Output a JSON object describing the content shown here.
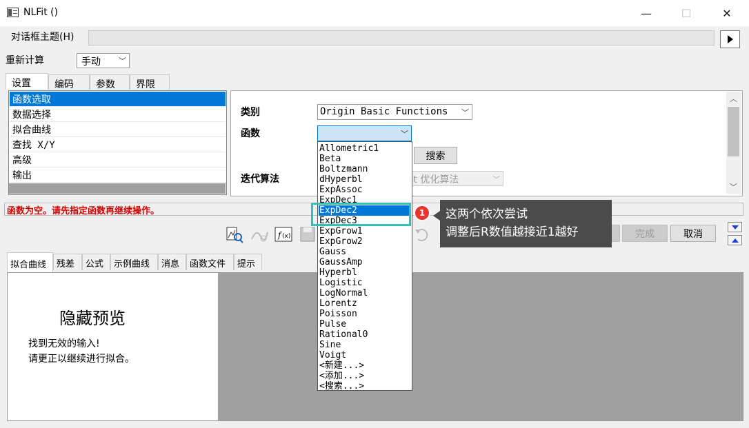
{
  "window": {
    "title": "NLFit ()",
    "minimize_glyph": "—",
    "maximize_glyph": "☐",
    "close_glyph": "✕"
  },
  "theme": {
    "label": "对话框主题(H)",
    "value": ""
  },
  "recalc": {
    "label": "重新计算",
    "value": "手动"
  },
  "tabs": [
    {
      "label": "设置"
    },
    {
      "label": "编码"
    },
    {
      "label": "参数"
    },
    {
      "label": "界限"
    }
  ],
  "settings_list": [
    {
      "label": "函数选取"
    },
    {
      "label": "数据选择"
    },
    {
      "label": "拟合曲线"
    },
    {
      "label": "查找 X/Y"
    },
    {
      "label": "高级"
    },
    {
      "label": "输出"
    }
  ],
  "panel": {
    "category_label": "类别",
    "category_value": "Origin Basic Functions",
    "function_label": "函数",
    "function_value": "",
    "search_button": "搜索",
    "iteration_label": "迭代算法",
    "iteration_value": "rdt 优化算法"
  },
  "error_text": "函数为空。请先指定函数再继续操作。",
  "buttons": {
    "finish": "完成",
    "cancel": "取消"
  },
  "bottom_tabs": [
    {
      "label": "拟合曲线"
    },
    {
      "label": "残差"
    },
    {
      "label": "公式"
    },
    {
      "label": "示例曲线"
    },
    {
      "label": "消息"
    },
    {
      "label": "函数文件"
    },
    {
      "label": "提示"
    }
  ],
  "preview": {
    "title": "隐藏预览",
    "line1": "找到无效的输入!",
    "line2": "请更正以继续进行拟合。"
  },
  "function_options": [
    "Allometric1",
    "Beta",
    "Boltzmann",
    "dHyperbl",
    "ExpAssoc",
    "ExpDec1",
    "ExpDec2",
    "ExpDec3",
    "ExpGrow1",
    "ExpGrow2",
    "Gauss",
    "GaussAmp",
    "Hyperbl",
    "Logistic",
    "LogNormal",
    "Lorentz",
    "Poisson",
    "Pulse",
    "Rational0",
    "Sine",
    "Voigt",
    "<新建...>",
    "<添加...>",
    "<搜索...>"
  ],
  "highlighted_option": "ExpDec2",
  "annotation": {
    "number": "1",
    "line1": "这两个依次尝试",
    "line2": "调整后R数值越接近1越好"
  },
  "colors": {
    "selection": "#0078d7",
    "error": "#d40000",
    "highlight_box": "#30c2b8",
    "annotation_bg": "#4b4b4b",
    "annotation_dot": "#e8332e"
  }
}
